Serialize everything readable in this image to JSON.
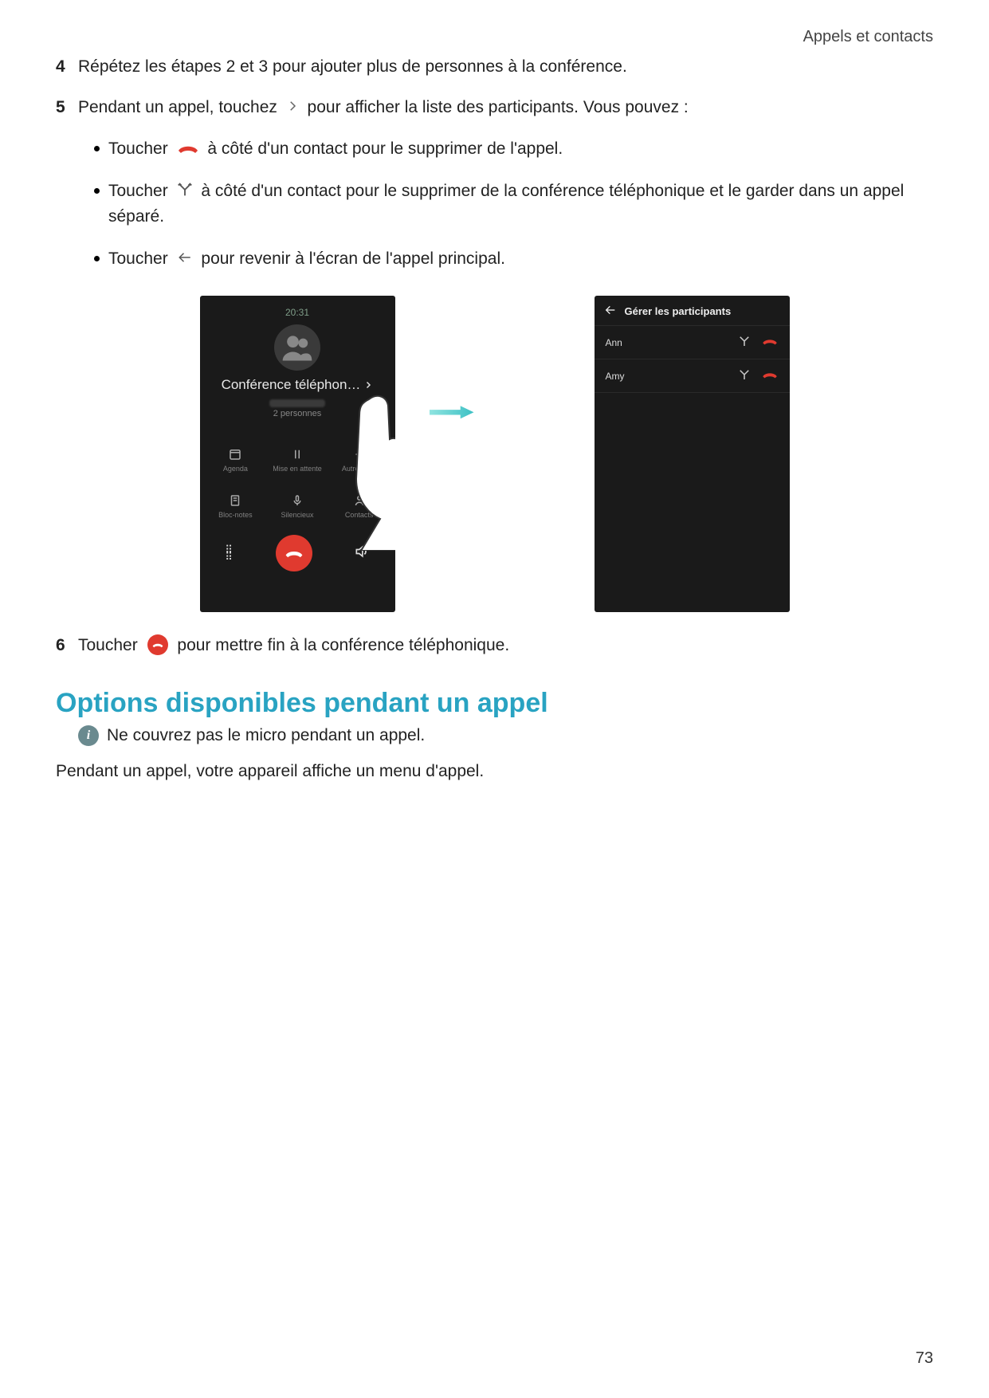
{
  "header": {
    "breadcrumb": "Appels et contacts"
  },
  "steps": {
    "s4": {
      "num": "4",
      "text": "Répétez les étapes 2 et 3 pour ajouter plus de personnes à la conférence."
    },
    "s5": {
      "num": "5",
      "text_before": "Pendant un appel, touchez ",
      "text_after": " pour afficher la liste des participants. Vous pouvez :",
      "bullets": {
        "b1": {
          "pre": "Toucher ",
          "post": " à côté d'un contact pour le supprimer de l'appel."
        },
        "b2": {
          "pre": "Toucher ",
          "post": " à côté d'un contact pour le supprimer de la conférence téléphonique et le garder dans un appel séparé."
        },
        "b3": {
          "pre": "Toucher ",
          "post": " pour revenir à l'écran de l'appel principal."
        }
      }
    },
    "s6": {
      "num": "6",
      "pre": "Toucher ",
      "post": " pour mettre fin à la conférence téléphonique."
    }
  },
  "section_heading": "Options disponibles pendant un appel",
  "info_note": "Ne couvrez pas le micro pendant un appel.",
  "paragraph": "Pendant un appel, votre appareil affiche un menu d'appel.",
  "page_number": "73",
  "figure": {
    "left": {
      "time": "20:31",
      "title": "Conférence téléphon…",
      "people": "2 personnes",
      "buttons": {
        "agenda": "Agenda",
        "hold": "Mise en attente",
        "other": "Autreappel",
        "notes": "Bloc-notes",
        "mute": "Silencieux",
        "contacts": "Contacts"
      }
    },
    "right": {
      "title": "Gérer les participants",
      "rows": {
        "r1": "Ann",
        "r2": "Amy"
      }
    }
  }
}
